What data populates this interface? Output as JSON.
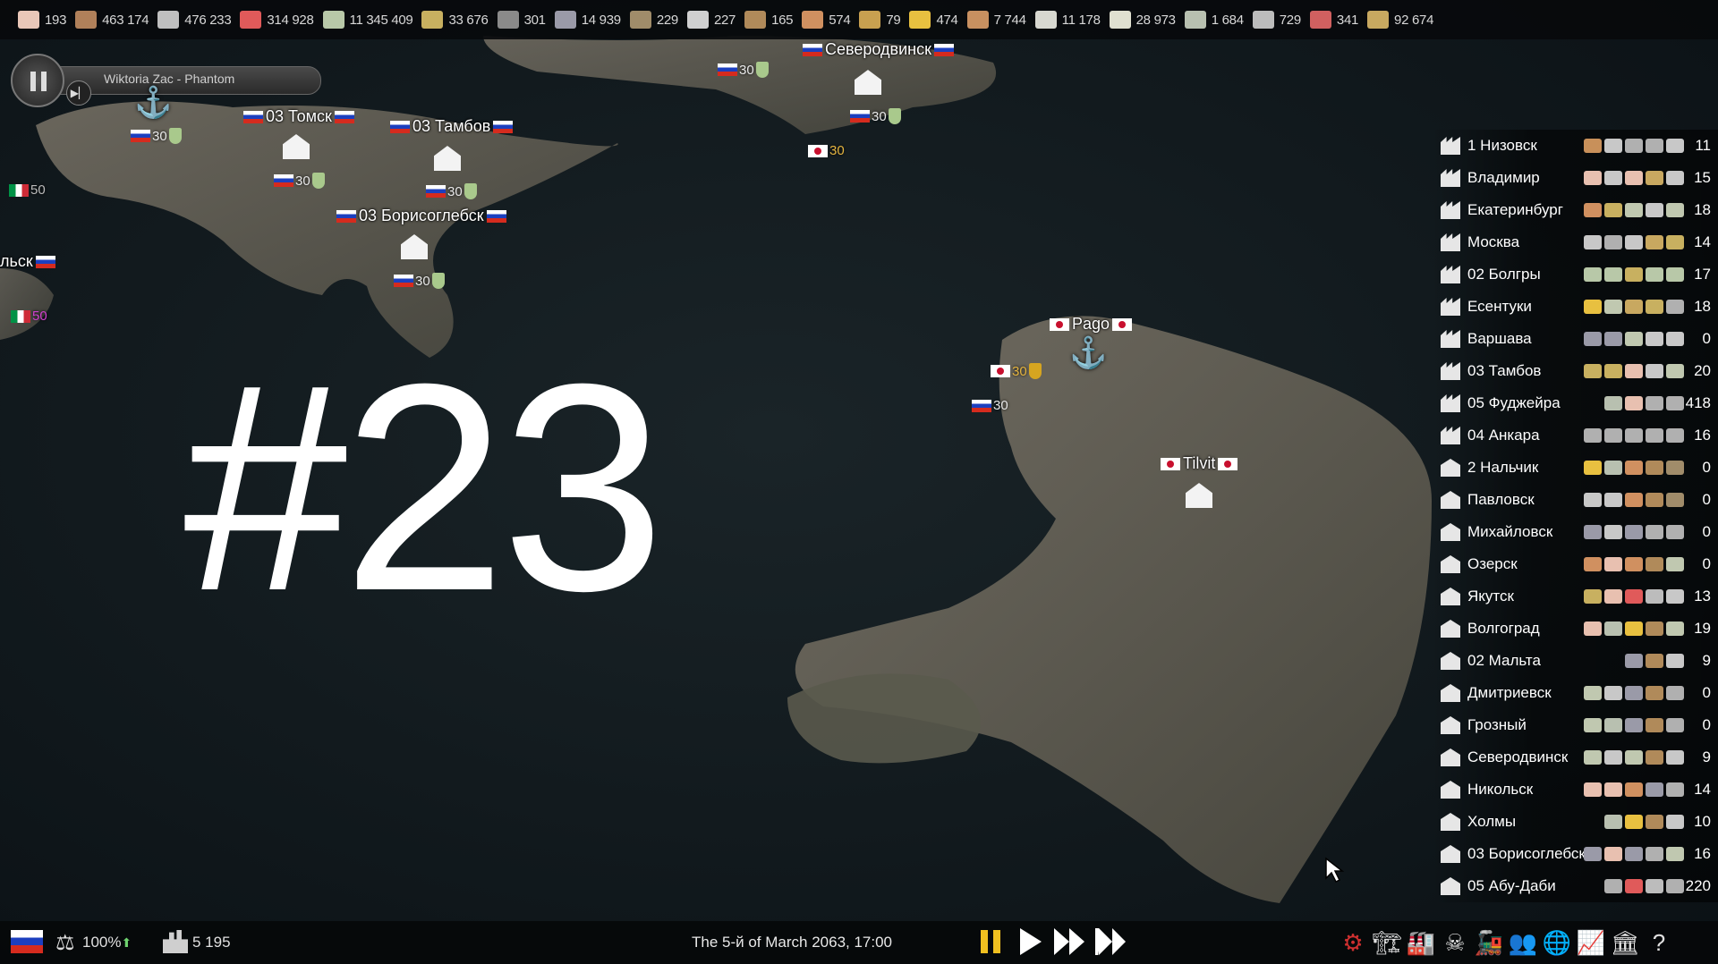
{
  "resources": [
    {
      "icon": "paper-icon",
      "value": "193",
      "color": "#e9c7b8"
    },
    {
      "icon": "wood-log-icon",
      "value": "463 174",
      "color": "#b0805a"
    },
    {
      "icon": "feather-icon",
      "value": "476 233",
      "color": "#bfbfbf"
    },
    {
      "icon": "canister-icon",
      "value": "314 928",
      "color": "#e05a5a"
    },
    {
      "icon": "cash-icon",
      "value": "11 345 409",
      "color": "#b8c8a8"
    },
    {
      "icon": "wheat-icon",
      "value": "33 676",
      "color": "#c8b060"
    },
    {
      "icon": "ore-pile-icon",
      "value": "301",
      "color": "#8a8a8a"
    },
    {
      "icon": "steel-bar-icon",
      "value": "14 939",
      "color": "#9a9aa8"
    },
    {
      "icon": "gravel-pile-icon",
      "value": "229",
      "color": "#a08c6a"
    },
    {
      "icon": "aluminium-icon",
      "value": "227",
      "color": "#d0d0d0"
    },
    {
      "icon": "coal-pile-icon",
      "value": "165",
      "color": "#b08a5a"
    },
    {
      "icon": "wooden-plank-icon",
      "value": "574",
      "color": "#d09060"
    },
    {
      "icon": "sand-pile-icon",
      "value": "79",
      "color": "#c8a050"
    },
    {
      "icon": "gold-bar-icon",
      "value": "474",
      "color": "#e8c040"
    },
    {
      "icon": "timber-icon",
      "value": "7 744",
      "color": "#c89060"
    },
    {
      "icon": "concrete-block-icon",
      "value": "11 178",
      "color": "#d8d8d0"
    },
    {
      "icon": "cotton-icon",
      "value": "28 973",
      "color": "#e0e0d0"
    },
    {
      "icon": "fabric-icon",
      "value": "1 684",
      "color": "#b8c0b0"
    },
    {
      "icon": "bottle-icon",
      "value": "729",
      "color": "#bcbcbc"
    },
    {
      "icon": "meat-icon",
      "value": "341",
      "color": "#d06060"
    },
    {
      "icon": "grain-icon",
      "value": "92 674",
      "color": "#c8a860"
    }
  ],
  "music_player": {
    "track": "Wiktoria Zac - Phantom"
  },
  "map": {
    "places": [
      {
        "name": "03 Томск",
        "flag": "ru"
      },
      {
        "name": "03 Тамбов",
        "flag": "ru"
      },
      {
        "name": "03 Борисоглебск",
        "flag": "ru"
      },
      {
        "name": "Северодвинск",
        "flag": "ru"
      },
      {
        "name": "льск",
        "flag": "ru"
      },
      {
        "name": "Pago",
        "flag": "jp"
      },
      {
        "name": "Tilvit",
        "flag": "jp"
      }
    ],
    "unit_strength": "30",
    "it_strength": "50"
  },
  "episode": "#23",
  "cities": [
    {
      "name": "1 Низовск",
      "count": "11",
      "type": "factory",
      "goods": [
        "#c8905a",
        "#c8c8c8",
        "#b0b0b0",
        "#b0b0b0",
        "#c8c8c8"
      ]
    },
    {
      "name": "Владимир",
      "count": "15",
      "type": "factory",
      "goods": [
        "#e8c0b0",
        "#c8c8c8",
        "#e8c0b0",
        "#c8a860",
        "#c8c8c8"
      ]
    },
    {
      "name": "Екатеринбург",
      "count": "18",
      "type": "factory",
      "goods": [
        "#d09060",
        "#c8b060",
        "#c0c8b0",
        "#c8c8c8",
        "#c0c8b0"
      ]
    },
    {
      "name": "Москва",
      "count": "14",
      "type": "factory",
      "goods": [
        "#c8c8c8",
        "#b0b0b0",
        "#c8c8c8",
        "#c8a860",
        "#c8b060"
      ]
    },
    {
      "name": "02 Болгры",
      "count": "17",
      "type": "factory",
      "goods": [
        "#b8c8a8",
        "#b8c8a8",
        "#c8b060",
        "#b8c8a8",
        "#b8c8a8"
      ]
    },
    {
      "name": "Есентуки",
      "count": "18",
      "type": "factory",
      "goods": [
        "#e8c040",
        "#c0c8b0",
        "#c8a860",
        "#c8b060",
        "#b0b0b0"
      ]
    },
    {
      "name": "Варшава",
      "count": "0",
      "type": "factory",
      "goods": [
        "#9a9aa8",
        "#9a9aa8",
        "#c0c8b0",
        "#c8c8c8",
        "#c8c8c8"
      ]
    },
    {
      "name": "03 Тамбов",
      "count": "20",
      "type": "factory",
      "goods": [
        "#c8b060",
        "#c8b060",
        "#e8c0b0",
        "#c8c8c8",
        "#c0c8b0"
      ]
    },
    {
      "name": "05 Фуджейра",
      "count": "418",
      "type": "factory",
      "goods": [
        "#b8c0b0",
        "#e8c0b0",
        "#b0b0b0",
        "#b0b0b0"
      ]
    },
    {
      "name": "04 Анкара",
      "count": "16",
      "type": "factory",
      "goods": [
        "#b0b0b0",
        "#b0b0b0",
        "#b0b0b0",
        "#b0b0b0",
        "#b0b0b0"
      ]
    },
    {
      "name": "2 Нальчик",
      "count": "0",
      "type": "house",
      "goods": [
        "#e8c040",
        "#b8c0b0",
        "#d09060",
        "#b08a5a",
        "#a08c6a"
      ]
    },
    {
      "name": "Павловск",
      "count": "0",
      "type": "house",
      "goods": [
        "#c8c8c8",
        "#c8c8c8",
        "#d09060",
        "#b08a5a",
        "#a08c6a"
      ]
    },
    {
      "name": "Михайловск",
      "count": "0",
      "type": "house",
      "goods": [
        "#9a9aa8",
        "#c8c8c8",
        "#9a9aa8",
        "#b0b0b0",
        "#b0b0b0"
      ]
    },
    {
      "name": "Озерск",
      "count": "0",
      "type": "house",
      "goods": [
        "#d09060",
        "#e8c0b0",
        "#d09060",
        "#b08a5a",
        "#c0c8b0"
      ]
    },
    {
      "name": "Якутск",
      "count": "13",
      "type": "house",
      "goods": [
        "#c8b060",
        "#e8c0b0",
        "#e05a5a",
        "#bcbcbc",
        "#c8c8c8"
      ]
    },
    {
      "name": "Волгоград",
      "count": "19",
      "type": "house",
      "goods": [
        "#e8c0b0",
        "#b8c0b0",
        "#e8c040",
        "#b08a5a",
        "#c0c8b0"
      ]
    },
    {
      "name": "02 Мальта",
      "count": "9",
      "type": "house",
      "goods": [
        "#9a9aa8",
        "#b08a5a",
        "#c8c8c8"
      ]
    },
    {
      "name": "Дмитриевск",
      "count": "0",
      "type": "house",
      "goods": [
        "#c0c8b0",
        "#c8c8c8",
        "#9a9aa8",
        "#b08a5a",
        "#b0b0b0"
      ]
    },
    {
      "name": "Грозный",
      "count": "0",
      "type": "house",
      "goods": [
        "#c0c8b0",
        "#b8c0b0",
        "#9a9aa8",
        "#b08a5a",
        "#b0b0b0"
      ]
    },
    {
      "name": "Северодвинск",
      "count": "9",
      "type": "house",
      "goods": [
        "#c0c8b0",
        "#c8c8c8",
        "#c0c8b0",
        "#b08a5a",
        "#c8c8c8"
      ]
    },
    {
      "name": "Никольск",
      "count": "14",
      "type": "house",
      "goods": [
        "#e8c0b0",
        "#e8c0b0",
        "#d09060",
        "#9a9aa8",
        "#b0b0b0"
      ]
    },
    {
      "name": "Холмы",
      "count": "10",
      "type": "house",
      "goods": [
        "#b8c0b0",
        "#e8c040",
        "#b08a5a",
        "#c8c8c8"
      ]
    },
    {
      "name": "03 Борисоглебск",
      "count": "16",
      "type": "house",
      "goods": [
        "#9a9aa8",
        "#e8c0b0",
        "#9a9aa8",
        "#b0b0b0",
        "#c0c8b0"
      ]
    },
    {
      "name": "05 Абу-Даби",
      "count": "220",
      "type": "house",
      "goods": [
        "#b0b0b0",
        "#e05a5a",
        "#bcbcbc",
        "#b0b0b0"
      ]
    }
  ],
  "bottom": {
    "approval": "100%",
    "population": "5 195",
    "datetime": "The 5-й of March 2063, 17:00"
  },
  "tools": [
    {
      "icon": "research-gear-icon",
      "color": "#d03030"
    },
    {
      "icon": "construction-crane-icon",
      "color": "#e0e0e0"
    },
    {
      "icon": "industry-icon",
      "color": "#e0e0e0"
    },
    {
      "icon": "military-skull-icon",
      "color": "#e0e0e0"
    },
    {
      "icon": "trade-icon",
      "color": "#d03030"
    },
    {
      "icon": "population-icon",
      "color": "#d03030"
    },
    {
      "icon": "diplomacy-globe-icon",
      "color": "#d03030"
    },
    {
      "icon": "statistics-icon",
      "color": "#e0e0e0"
    },
    {
      "icon": "government-icon",
      "color": "#e0e0e0"
    },
    {
      "icon": "help-icon",
      "color": "#e0e0e0"
    }
  ]
}
